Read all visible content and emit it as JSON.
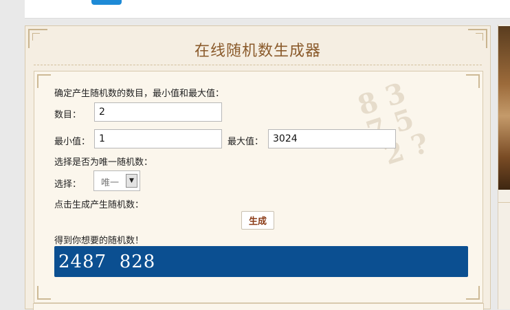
{
  "tool": {
    "title": "在线随机数生成器",
    "section1_label": "确定产生随机数的数目，最小值和最大值：",
    "count": {
      "label": "数目：",
      "value": "2"
    },
    "min": {
      "label": "最小值：",
      "value": "1"
    },
    "max": {
      "label": "最大值：",
      "value": "3024"
    },
    "unique_prompt": "选择是否为唯一随机数：",
    "select": {
      "label": "选择：",
      "selected": "唯一"
    },
    "generate_prompt": "点击生成产生随机数：",
    "generate_button": "生成",
    "result_label": "得到你想要的随机数！",
    "result_value": "2487  828"
  },
  "colors": {
    "title": "#8a5a2b",
    "button_text": "#8a3a15",
    "result_bg": "#0b4f91",
    "panel_bg": "#f5eee2"
  }
}
